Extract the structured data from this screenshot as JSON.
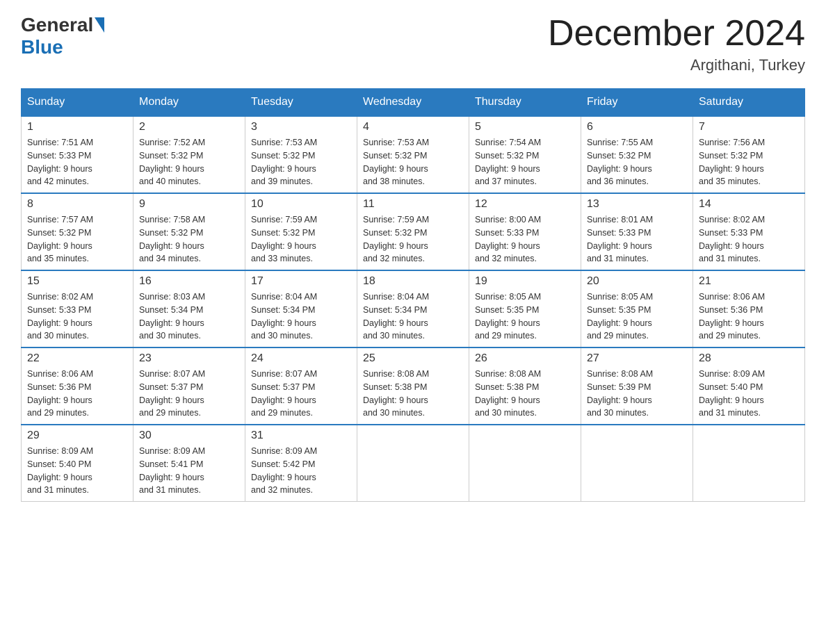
{
  "header": {
    "logo": {
      "text1": "General",
      "text2": "Blue"
    },
    "title": "December 2024",
    "location": "Argithani, Turkey"
  },
  "weekdays": [
    "Sunday",
    "Monday",
    "Tuesday",
    "Wednesday",
    "Thursday",
    "Friday",
    "Saturday"
  ],
  "weeks": [
    [
      {
        "day": "1",
        "sunrise": "7:51 AM",
        "sunset": "5:33 PM",
        "daylight": "9 hours and 42 minutes."
      },
      {
        "day": "2",
        "sunrise": "7:52 AM",
        "sunset": "5:32 PM",
        "daylight": "9 hours and 40 minutes."
      },
      {
        "day": "3",
        "sunrise": "7:53 AM",
        "sunset": "5:32 PM",
        "daylight": "9 hours and 39 minutes."
      },
      {
        "day": "4",
        "sunrise": "7:53 AM",
        "sunset": "5:32 PM",
        "daylight": "9 hours and 38 minutes."
      },
      {
        "day": "5",
        "sunrise": "7:54 AM",
        "sunset": "5:32 PM",
        "daylight": "9 hours and 37 minutes."
      },
      {
        "day": "6",
        "sunrise": "7:55 AM",
        "sunset": "5:32 PM",
        "daylight": "9 hours and 36 minutes."
      },
      {
        "day": "7",
        "sunrise": "7:56 AM",
        "sunset": "5:32 PM",
        "daylight": "9 hours and 35 minutes."
      }
    ],
    [
      {
        "day": "8",
        "sunrise": "7:57 AM",
        "sunset": "5:32 PM",
        "daylight": "9 hours and 35 minutes."
      },
      {
        "day": "9",
        "sunrise": "7:58 AM",
        "sunset": "5:32 PM",
        "daylight": "9 hours and 34 minutes."
      },
      {
        "day": "10",
        "sunrise": "7:59 AM",
        "sunset": "5:32 PM",
        "daylight": "9 hours and 33 minutes."
      },
      {
        "day": "11",
        "sunrise": "7:59 AM",
        "sunset": "5:32 PM",
        "daylight": "9 hours and 32 minutes."
      },
      {
        "day": "12",
        "sunrise": "8:00 AM",
        "sunset": "5:33 PM",
        "daylight": "9 hours and 32 minutes."
      },
      {
        "day": "13",
        "sunrise": "8:01 AM",
        "sunset": "5:33 PM",
        "daylight": "9 hours and 31 minutes."
      },
      {
        "day": "14",
        "sunrise": "8:02 AM",
        "sunset": "5:33 PM",
        "daylight": "9 hours and 31 minutes."
      }
    ],
    [
      {
        "day": "15",
        "sunrise": "8:02 AM",
        "sunset": "5:33 PM",
        "daylight": "9 hours and 30 minutes."
      },
      {
        "day": "16",
        "sunrise": "8:03 AM",
        "sunset": "5:34 PM",
        "daylight": "9 hours and 30 minutes."
      },
      {
        "day": "17",
        "sunrise": "8:04 AM",
        "sunset": "5:34 PM",
        "daylight": "9 hours and 30 minutes."
      },
      {
        "day": "18",
        "sunrise": "8:04 AM",
        "sunset": "5:34 PM",
        "daylight": "9 hours and 30 minutes."
      },
      {
        "day": "19",
        "sunrise": "8:05 AM",
        "sunset": "5:35 PM",
        "daylight": "9 hours and 29 minutes."
      },
      {
        "day": "20",
        "sunrise": "8:05 AM",
        "sunset": "5:35 PM",
        "daylight": "9 hours and 29 minutes."
      },
      {
        "day": "21",
        "sunrise": "8:06 AM",
        "sunset": "5:36 PM",
        "daylight": "9 hours and 29 minutes."
      }
    ],
    [
      {
        "day": "22",
        "sunrise": "8:06 AM",
        "sunset": "5:36 PM",
        "daylight": "9 hours and 29 minutes."
      },
      {
        "day": "23",
        "sunrise": "8:07 AM",
        "sunset": "5:37 PM",
        "daylight": "9 hours and 29 minutes."
      },
      {
        "day": "24",
        "sunrise": "8:07 AM",
        "sunset": "5:37 PM",
        "daylight": "9 hours and 29 minutes."
      },
      {
        "day": "25",
        "sunrise": "8:08 AM",
        "sunset": "5:38 PM",
        "daylight": "9 hours and 30 minutes."
      },
      {
        "day": "26",
        "sunrise": "8:08 AM",
        "sunset": "5:38 PM",
        "daylight": "9 hours and 30 minutes."
      },
      {
        "day": "27",
        "sunrise": "8:08 AM",
        "sunset": "5:39 PM",
        "daylight": "9 hours and 30 minutes."
      },
      {
        "day": "28",
        "sunrise": "8:09 AM",
        "sunset": "5:40 PM",
        "daylight": "9 hours and 31 minutes."
      }
    ],
    [
      {
        "day": "29",
        "sunrise": "8:09 AM",
        "sunset": "5:40 PM",
        "daylight": "9 hours and 31 minutes."
      },
      {
        "day": "30",
        "sunrise": "8:09 AM",
        "sunset": "5:41 PM",
        "daylight": "9 hours and 31 minutes."
      },
      {
        "day": "31",
        "sunrise": "8:09 AM",
        "sunset": "5:42 PM",
        "daylight": "9 hours and 32 minutes."
      },
      null,
      null,
      null,
      null
    ]
  ],
  "labels": {
    "sunrise": "Sunrise:",
    "sunset": "Sunset:",
    "daylight": "Daylight:"
  }
}
